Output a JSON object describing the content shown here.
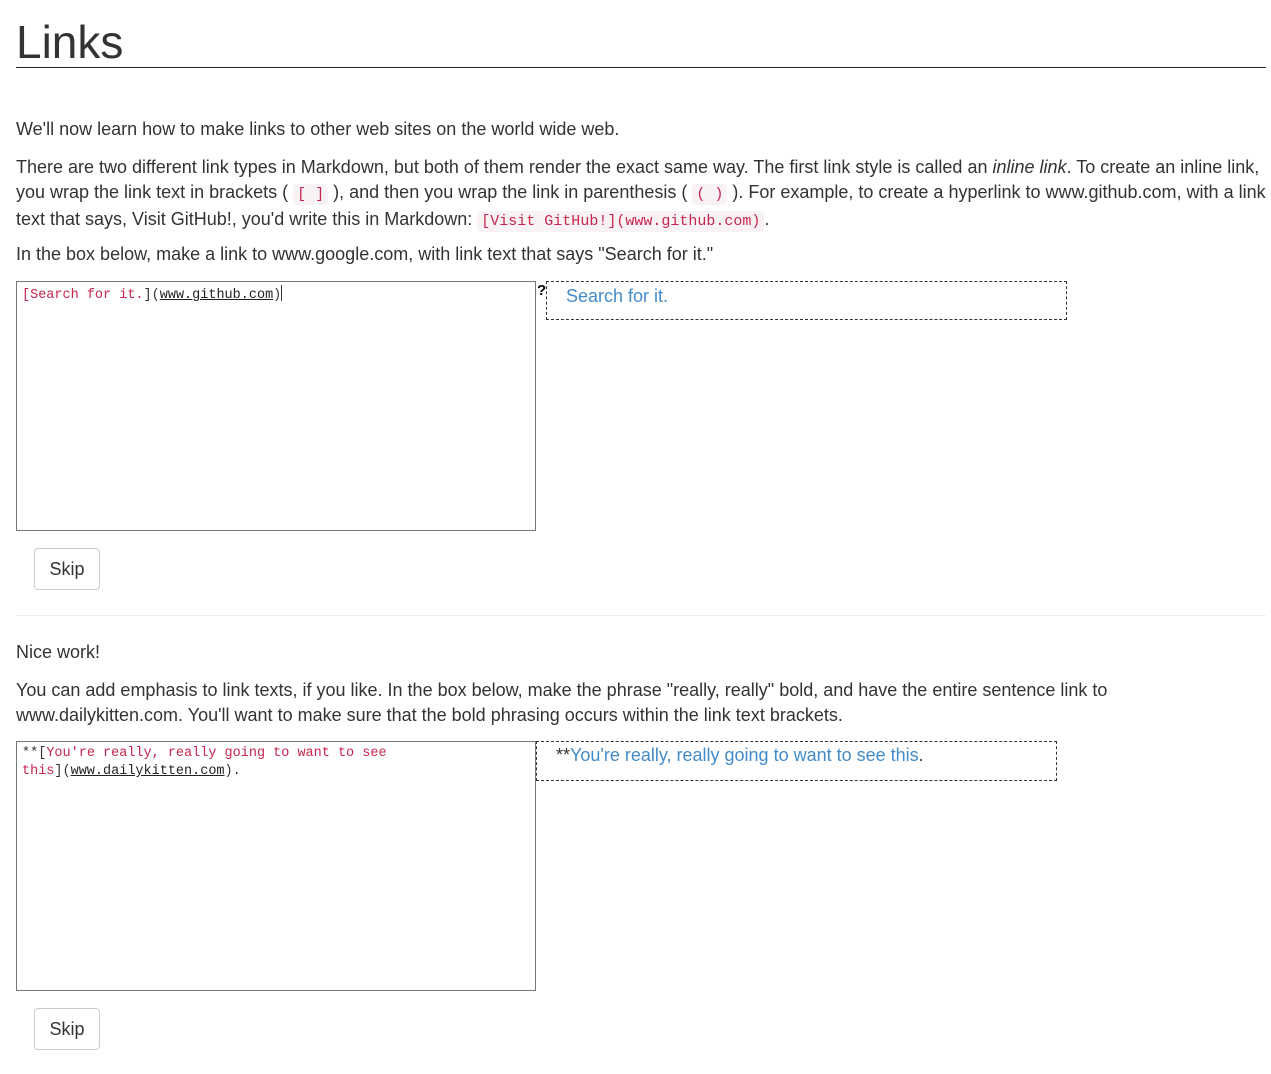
{
  "title": "Links",
  "section1": {
    "intro": "We'll now learn how to make links to other web sites on the world wide web.",
    "p2": {
      "a": "There are two different link types in Markdown, but both of them render the exact same way. The first link style is called an ",
      "em": "inline link",
      "b": ". To create an inline link, you wrap the link text in brackets ( ",
      "code1": "[ ]",
      "c": " ), and then you wrap the link in parenthesis ( ",
      "code2": "( )",
      "d": " ). For example, to create a hyperlink to www.github.com, with a link text that says, Visit GitHub!, you'd write this in Markdown: ",
      "code3": "[Visit GitHub!](www.github.com)",
      "e": "."
    },
    "instruction": "In the box below, make a link to www.google.com, with link text that says \"Search for it.\"",
    "editor": {
      "open_bracket": "[",
      "link_text": "Search for it.",
      "close_bracket": "]",
      "open_paren": "(",
      "url": "www.github.com",
      "close_paren": ")"
    },
    "status_mark": "?",
    "preview_link": "Search for it.",
    "skip_label": "Skip"
  },
  "section2": {
    "nice": "Nice work!",
    "instruction": "You can add emphasis to link texts, if you like. In the box below, make the phrase \"really, really\" bold, and have the entire sentence link to www.dailykitten.com. You'll want to make sure that the bold phrasing occurs within the link text brackets.",
    "editor": {
      "prefix": "**[",
      "link_text_line1": "You're really, really going to want to see",
      "link_text_line2": "this",
      "close_bracket": "](",
      "url": "www.dailykitten.com",
      "suffix": ")."
    },
    "preview_stars": "**",
    "preview_link": "You're really, really going to want to see this",
    "preview_period": ".",
    "skip_label": "Skip"
  },
  "colors": {
    "link": "#428bca",
    "code": "#c7254e",
    "text": "#333333"
  }
}
